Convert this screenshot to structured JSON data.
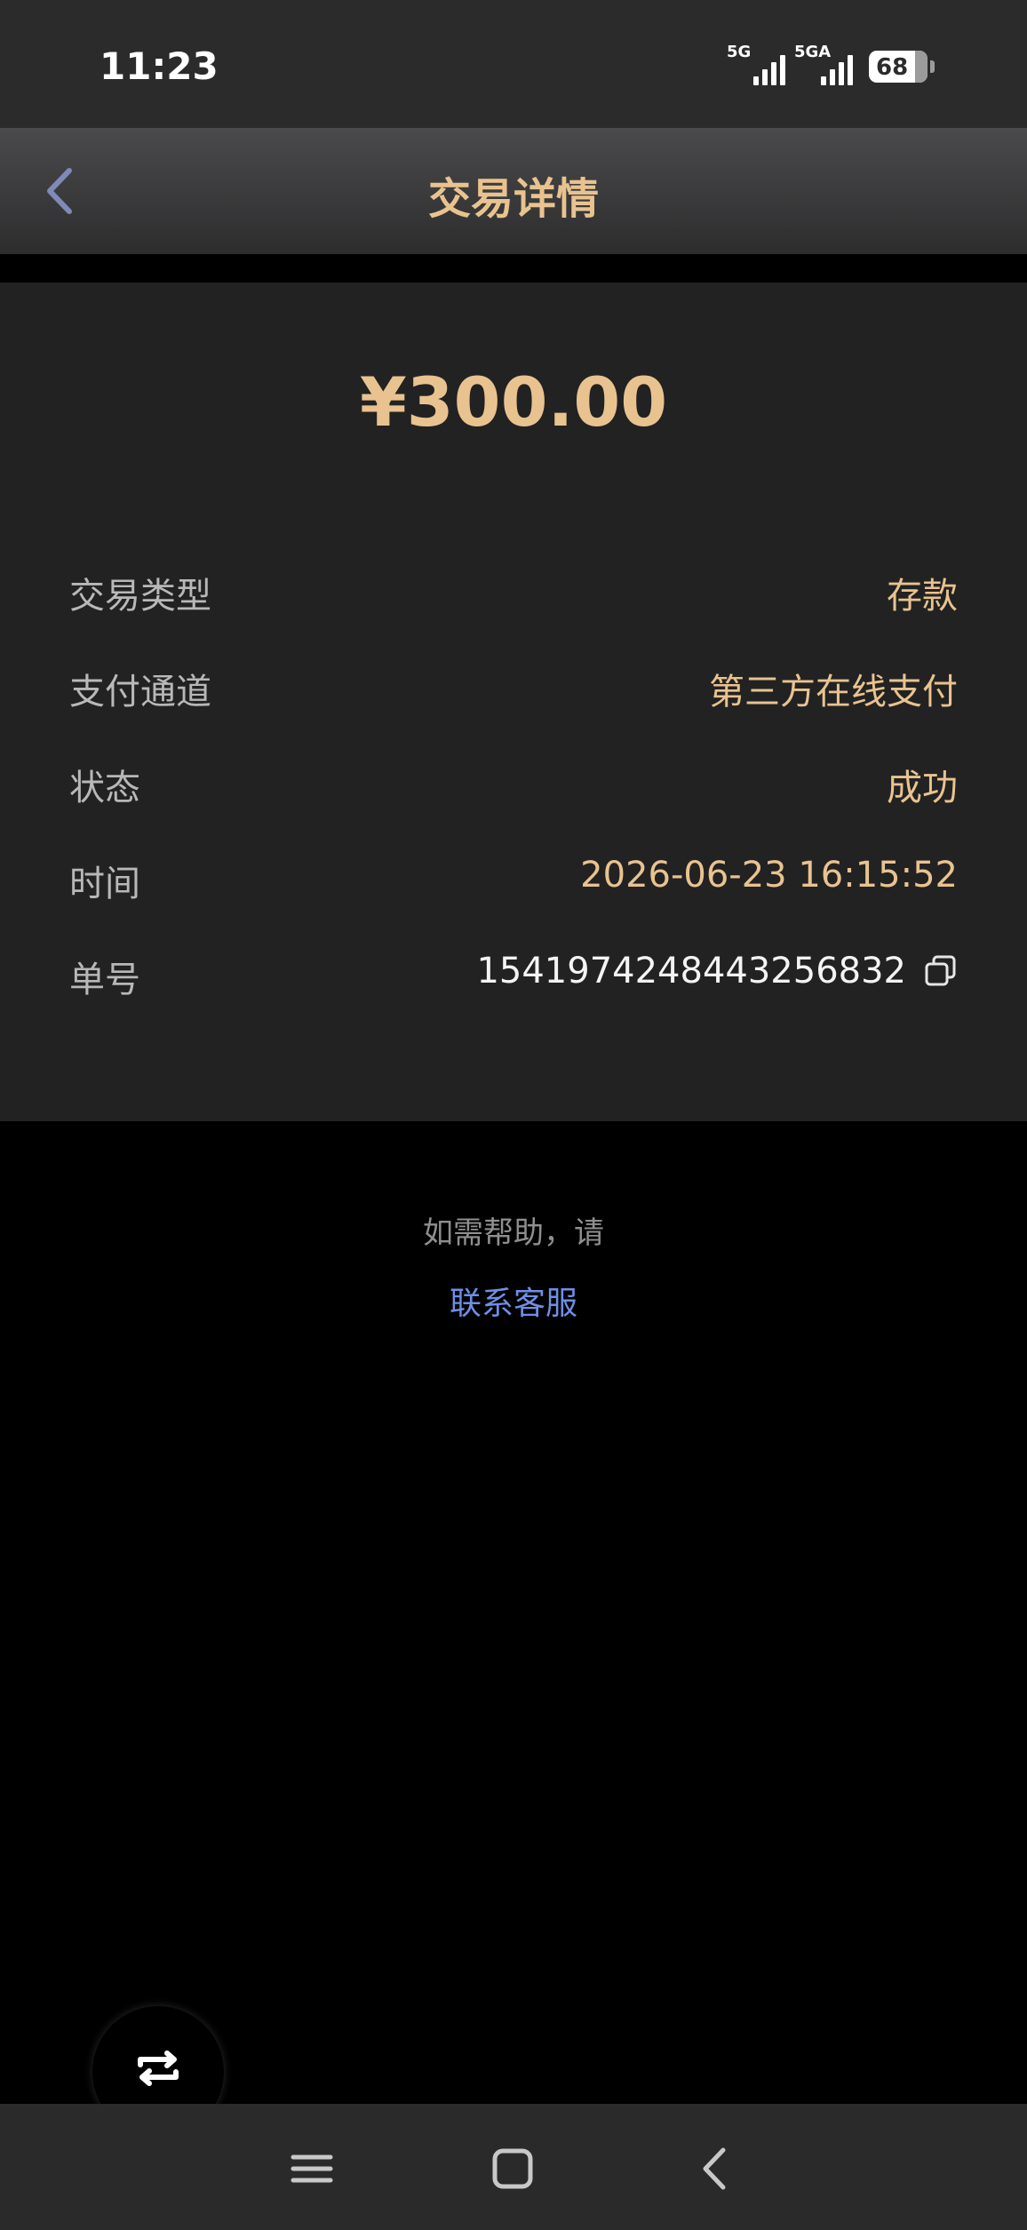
{
  "status_bar": {
    "time": "11:23",
    "signal1_label": "5G",
    "signal2_label": "5GA",
    "battery": "68"
  },
  "header": {
    "title": "交易详情",
    "back_icon": "chevron-left-icon"
  },
  "detail": {
    "amount": "¥300.00",
    "rows": [
      {
        "label": "交易类型",
        "value": "存款"
      },
      {
        "label": "支付通道",
        "value": "第三方在线支付"
      },
      {
        "label": "状态",
        "value": "成功"
      },
      {
        "label": "时间",
        "value": "2026-06-23 16:15:52"
      },
      {
        "label": "单号",
        "value": "1541974248443256832"
      }
    ],
    "copy_icon": "copy-icon"
  },
  "help": {
    "text": "如需帮助，请",
    "link": "联系客服"
  },
  "float_button": {
    "icon": "swap-icon"
  },
  "navbar": {
    "items": [
      "menu-icon",
      "home-icon",
      "back-icon"
    ]
  },
  "colors": {
    "accent_gold": "#e9c38f",
    "link_blue": "#6f8fe6",
    "card_bg": "#222223",
    "page_bg": "#000000"
  }
}
